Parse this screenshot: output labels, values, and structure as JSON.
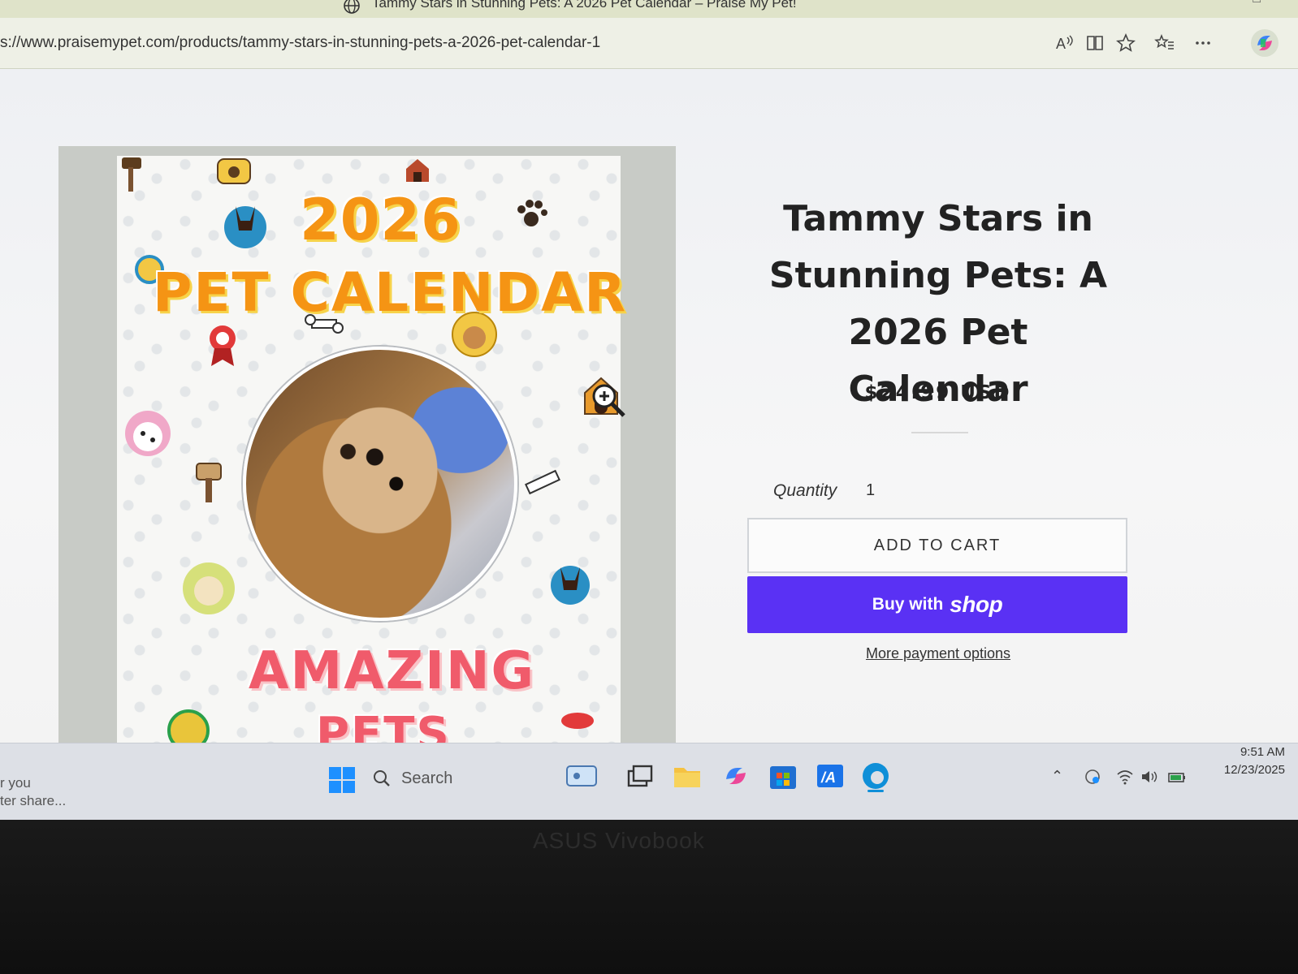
{
  "browser": {
    "tab_title": "Tammy Stars in Stunning Pets: A 2026 Pet Calendar – Praise My Pet!",
    "url": "s://www.praisemypet.com/products/tammy-stars-in-stunning-pets-a-2026-pet-calendar-1",
    "toolbar_icons": [
      "read-aloud-icon",
      "immersive-reader-icon",
      "favorite-star-icon",
      "favorites-list-icon",
      "more-icon",
      "copilot-icon"
    ]
  },
  "product": {
    "cover": {
      "year": "2026",
      "title": "PET CALENDAR",
      "subtitle_line1": "AMAZING",
      "subtitle_line2": "PETS"
    },
    "title": "Tammy Stars in Stunning Pets: A 2026 Pet Calendar",
    "price": "$24.99 USD",
    "quantity_label": "Quantity",
    "quantity_value": "1",
    "add_to_cart": "ADD TO CART",
    "buy_with": "Buy with",
    "shop": "shop",
    "more_payment": "More payment options"
  },
  "taskbar": {
    "notification_line1": "r you",
    "notification_line2": "ter share...",
    "search_placeholder": "Search",
    "time": "9:51 AM",
    "date": "12/23/2025"
  },
  "laptop": {
    "brand": "ASUS Vivobook"
  },
  "colors": {
    "shop_button": "#5a31f4",
    "cover_orange": "#f59414",
    "cover_pink": "#f05b6b"
  }
}
